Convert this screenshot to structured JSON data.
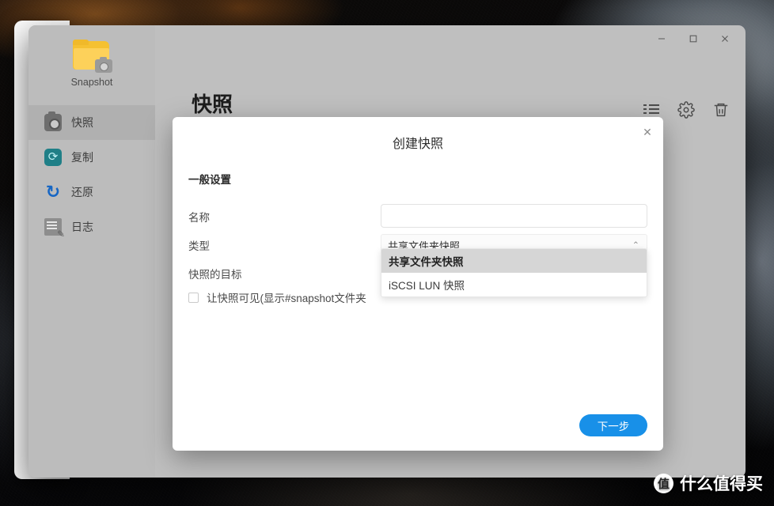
{
  "window": {
    "controls": [
      {
        "name": "minimize",
        "glyph": "–"
      },
      {
        "name": "maximize",
        "glyph": "□"
      },
      {
        "name": "close",
        "glyph": "✕"
      }
    ]
  },
  "sidebar": {
    "app_name": "Snapshot",
    "app_icon": "folder-camera-icon",
    "items": [
      {
        "label": "快照",
        "icon": "camera-icon",
        "active": true
      },
      {
        "label": "复制",
        "icon": "replicate-icon",
        "active": false
      },
      {
        "label": "还原",
        "icon": "restore-icon",
        "active": false
      },
      {
        "label": "日志",
        "icon": "log-icon",
        "active": false
      }
    ]
  },
  "content": {
    "page_title": "快照",
    "toolbar": [
      {
        "name": "list-view-icon",
        "glyph": ""
      },
      {
        "name": "gear-icon",
        "glyph": "⚙"
      },
      {
        "name": "trash-icon",
        "glyph": "🗑"
      }
    ]
  },
  "dialog": {
    "title": "创建快照",
    "close_glyph": "✕",
    "section_label": "一般设置",
    "fields": {
      "name": {
        "label": "名称",
        "value": "",
        "placeholder": ""
      },
      "type": {
        "label": "类型",
        "value": "共享文件夹快照",
        "chevron": "⌃"
      },
      "target": {
        "label": "快照的目标"
      }
    },
    "type_options": [
      {
        "label": "共享文件夹快照",
        "selected": true
      },
      {
        "label": "iSCSI LUN 快照",
        "selected": false
      }
    ],
    "checkbox": {
      "label": "让快照可见(显示#snapshot文件夹",
      "checked": false
    },
    "next_button": "下一步"
  },
  "watermark": {
    "logo": "值",
    "text": "什么值得买"
  },
  "colors": {
    "accent": "#1890e8",
    "window_bg": "#bfbfbf",
    "sidebar_bg": "#bcbcbc",
    "dialog_bg": "#ffffff",
    "option_selected_bg": "#d6d6d6"
  }
}
